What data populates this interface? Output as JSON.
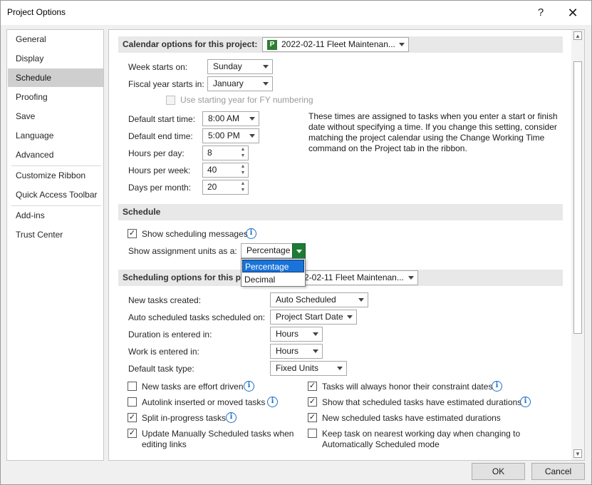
{
  "window": {
    "title": "Project Options",
    "help_glyph": "?",
    "close_glyph": "✕"
  },
  "nav": {
    "items": [
      "General",
      "Display",
      "Schedule",
      "Proofing",
      "Save",
      "Language",
      "Advanced",
      "Customize Ribbon",
      "Quick Access Toolbar",
      "Add-ins",
      "Trust Center"
    ],
    "selected": "Schedule"
  },
  "calendar": {
    "header": "Calendar options for this project:",
    "project_combo": "2022-02-11 Fleet Maintenan...",
    "week_starts_label": "Week starts on:",
    "week_starts_value": "Sunday",
    "fiscal_year_label": "Fiscal year starts in:",
    "fiscal_year_value": "January",
    "use_starting_year_label": "Use starting year for FY numbering",
    "default_start_label": "Default start time:",
    "default_start_value": "8:00 AM",
    "default_end_label": "Default end time:",
    "default_end_value": "5:00 PM",
    "hours_per_day_label": "Hours per day:",
    "hours_per_day_value": "8",
    "hours_per_week_label": "Hours per week:",
    "hours_per_week_value": "40",
    "days_per_month_label": "Days per month:",
    "days_per_month_value": "20",
    "explanation": "These times are assigned to tasks when you enter a start or finish date without specifying a time. If you change this setting, consider matching the project calendar using the Change Working Time command on the Project tab in the ribbon."
  },
  "schedule": {
    "header": "Schedule",
    "show_messages_label": "Show scheduling messages",
    "show_messages_checked": true,
    "assignment_units_label": "Show assignment units as a:",
    "assignment_units_value": "Percentage",
    "assignment_units_options": [
      "Percentage",
      "Decimal"
    ]
  },
  "scheduling_options": {
    "header": "Scheduling options for this pro",
    "project_combo": "2-02-11 Fleet Maintenan...",
    "new_tasks_label": "New tasks created:",
    "new_tasks_value": "Auto Scheduled",
    "auto_sched_label": "Auto scheduled tasks scheduled on:",
    "auto_sched_value": "Project Start Date",
    "duration_label": "Duration is entered in:",
    "duration_value": "Hours",
    "work_label": "Work is entered in:",
    "work_value": "Hours",
    "task_type_label": "Default task type:",
    "task_type_value": "Fixed Units",
    "checks_left": [
      {
        "label": "New tasks are effort driven",
        "checked": false,
        "info": true
      },
      {
        "label": "Autolink inserted or moved tasks",
        "checked": false,
        "info": true
      },
      {
        "label": "Split in-progress tasks",
        "checked": true,
        "info": true
      },
      {
        "label": "Update Manually Scheduled tasks when editing links",
        "checked": true,
        "info": false
      }
    ],
    "checks_right": [
      {
        "label": "Tasks will always honor their constraint dates",
        "checked": true,
        "info": true
      },
      {
        "label": "Show that scheduled tasks have estimated durations",
        "checked": true,
        "info": true
      },
      {
        "label": "New scheduled tasks have estimated durations",
        "checked": true,
        "info": false
      },
      {
        "label": "Keep task on nearest working day when changing to Automatically Scheduled mode",
        "checked": false,
        "info": false
      }
    ]
  },
  "buttons": {
    "ok": "OK",
    "cancel": "Cancel"
  },
  "colors": {
    "selected_nav": "#cfcfcf",
    "dropdown_highlight": "#1a73d9",
    "green_button": "#1e7b34",
    "info_blue": "#1e6fc6"
  }
}
